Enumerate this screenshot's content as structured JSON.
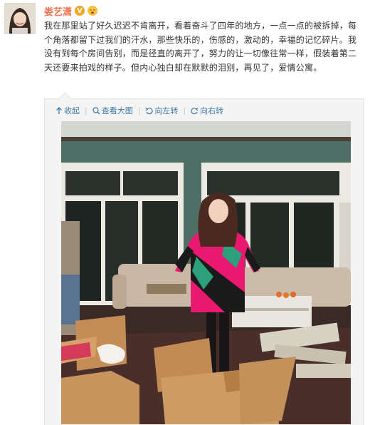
{
  "post": {
    "username": "娄艺潇",
    "verified_badge": "V",
    "emoji_badge": "emoji-face-icon",
    "text": "我在那里站了好久迟迟不肯离开，看着奋斗了四年的地方，一点一点的被拆掉，每个角落都留下过我们的汗水，那些快乐的，伤感的，激动的，幸福的记忆碎片。我没有到每个房间告别，而是径直的离开了，努力的让一切像往常一样，假装着第二天还要来拍戏的样子。但内心独白却在默默的泪别，再见了，爱情公寓。"
  },
  "toolbar": {
    "collapse": "收起",
    "view_large": "查看大图",
    "rotate_left": "向左转",
    "rotate_right": "向右转"
  },
  "colors": {
    "username": "#eb7350",
    "link": "#3d79a8",
    "panel_bg": "#f4f4f4"
  }
}
